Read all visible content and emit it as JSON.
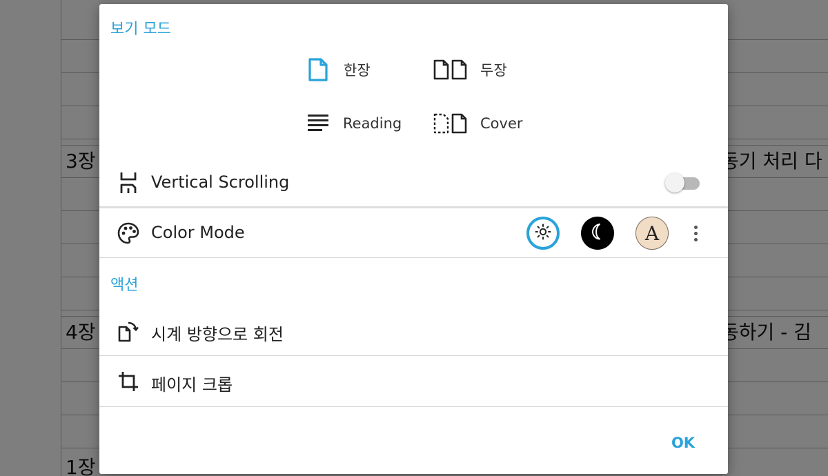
{
  "background": {
    "chapters": [
      {
        "left": "3장",
        "right": "동기 처리 다"
      },
      {
        "left": "4장",
        "right": "동하기 - 김"
      },
      {
        "left": "1장"
      }
    ]
  },
  "dialog": {
    "view_mode": {
      "title": "보기 모드",
      "options": [
        {
          "label": "한장",
          "icon": "single-page-icon",
          "selected": true
        },
        {
          "label": "두장",
          "icon": "double-page-icon"
        },
        {
          "label": "Reading",
          "icon": "reading-lines-icon"
        },
        {
          "label": "Cover",
          "icon": "cover-page-icon"
        }
      ]
    },
    "vertical_scrolling": {
      "label": "Vertical Scrolling",
      "enabled": false
    },
    "color_mode": {
      "label": "Color Mode",
      "options": [
        {
          "name": "light",
          "icon": "sun-icon",
          "selected": true
        },
        {
          "name": "dark",
          "icon": "moon-icon"
        },
        {
          "name": "sepia",
          "glyph": "A"
        }
      ]
    },
    "actions": {
      "title": "액션",
      "items": [
        {
          "label": "시계 방향으로 회전",
          "icon": "rotate-clockwise-icon"
        },
        {
          "label": "페이지 크롭",
          "icon": "crop-icon"
        }
      ]
    },
    "ok_label": "OK"
  },
  "colors": {
    "accent": "#29a3d9",
    "dark_mode": "#000000",
    "sepia_mode": "#f1dcc6",
    "toggle_track": "#b8b8b8"
  }
}
